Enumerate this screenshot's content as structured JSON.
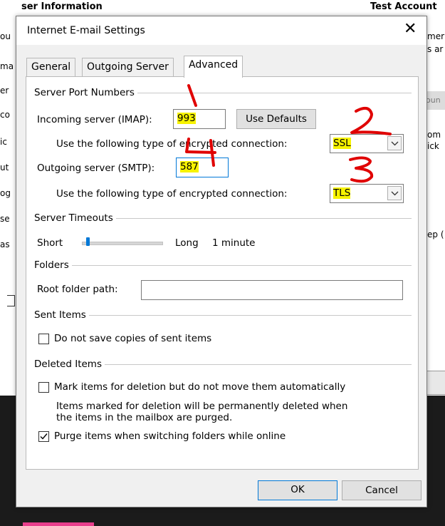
{
  "background": {
    "left_title": "ser Information",
    "right_title": "Test Account",
    "left_fragments": [
      "ou",
      "ma",
      "er",
      "co",
      "ic",
      "ut",
      "og",
      "se",
      "as"
    ],
    "right_fragments": [
      "mer",
      "s ar",
      "oun",
      "om",
      "ick",
      "ep (",
      ""
    ]
  },
  "dialog": {
    "title": "Internet E-mail Settings",
    "close_glyph": "✕",
    "tabs": [
      {
        "label": "General"
      },
      {
        "label": "Outgoing Server"
      },
      {
        "label": "Advanced",
        "active": true
      }
    ],
    "server_ports": {
      "group_label": "Server Port Numbers",
      "incoming_label": "Incoming server (IMAP):",
      "incoming_value": "993",
      "use_defaults_label": "Use Defaults",
      "incoming_encryption_label": "Use the following type of encrypted connection:",
      "incoming_encryption_value": "SSL",
      "outgoing_label": "Outgoing server (SMTP):",
      "outgoing_value": "587",
      "outgoing_encryption_label": "Use the following type of encrypted connection:",
      "outgoing_encryption_value": "TLS"
    },
    "timeouts": {
      "group_label": "Server Timeouts",
      "short_label": "Short",
      "long_label": "Long",
      "value_label": "1 minute",
      "slider_level": 0.06
    },
    "folders": {
      "group_label": "Folders",
      "root_label": "Root folder path:",
      "root_value": ""
    },
    "sent_items": {
      "group_label": "Sent Items",
      "no_save_label": "Do not save copies of sent items",
      "no_save_checked": false
    },
    "deleted_items": {
      "group_label": "Deleted Items",
      "mark_label": "Mark items for deletion but do not move them automatically",
      "mark_checked": false,
      "note_line1": "Items marked for deletion will be permanently deleted when",
      "note_line2": "the items in the mailbox are purged.",
      "purge_label": "Purge items when switching folders while online",
      "purge_checked": true
    },
    "buttons": {
      "ok": "OK",
      "cancel": "Cancel"
    }
  },
  "annotations": {
    "color": "#e00000",
    "marks": [
      "1",
      "2",
      "3",
      "4"
    ]
  },
  "colors": {
    "highlight": "#f7f300",
    "focus_border": "#0078d7",
    "annotation_red": "#e00000"
  }
}
